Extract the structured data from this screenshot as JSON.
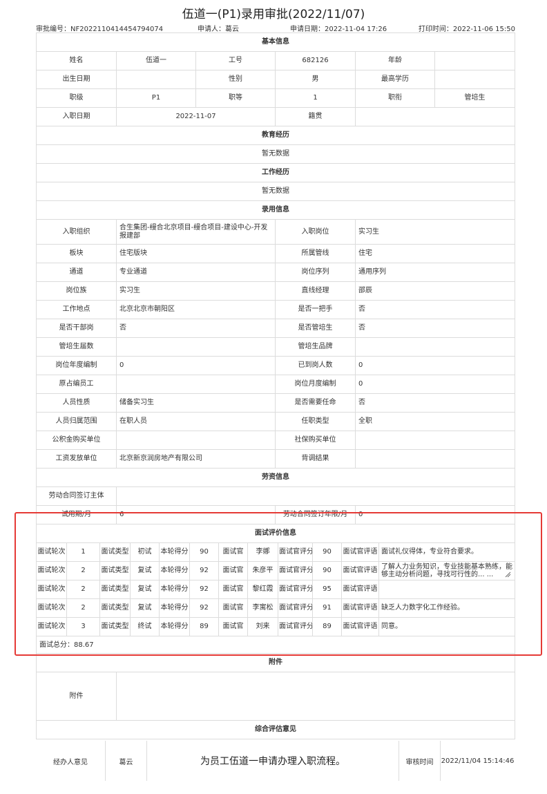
{
  "title": "伍道一(P1)录用审批(2022/11/07)",
  "meta": {
    "approval_no": "审批编号：NF20221104144547940​74",
    "applicant": "申请人：葛云",
    "apply_date": "申请日期：2022-11-04 17:26",
    "print_time": "打印时间：2022-11-06 15:50"
  },
  "sections": {
    "basic": "基本信息",
    "education": "教育经历",
    "work": "工作经历",
    "hire": "录用信息",
    "labor": "劳资信息",
    "interview": "面试评价信息",
    "attachment": "附件",
    "overall": "综合评估意见"
  },
  "basic": {
    "name_label": "姓名",
    "name": "伍道一",
    "empno_label": "工号",
    "empno": "682126",
    "age_label": "年龄",
    "age": "",
    "birth_label": "出生日期",
    "birth": "",
    "gender_label": "性别",
    "gender": "男",
    "degree_label": "最高学历",
    "degree": "",
    "level_label": "职级",
    "level": "P1",
    "grade_label": "职等",
    "grade": "1",
    "rank_label": "职衔",
    "rank": "管培生",
    "entry_label": "入职日期",
    "entry": "2022-11-07",
    "origin_label": "籍贯",
    "origin": ""
  },
  "education_empty": "暂无数据",
  "work_empty": "暂无数据",
  "hire_rows": [
    [
      "入职组织",
      "合生集团-缦合北京项目-缦合项目-建设中心-开发报建部",
      "入职岗位",
      "实习生"
    ],
    [
      "板块",
      "住宅版块",
      "所属管线",
      "住宅"
    ],
    [
      "通道",
      "专业通道",
      "岗位序列",
      "通用序列"
    ],
    [
      "岗位族",
      "实习生",
      "直线经理",
      "邵辰"
    ],
    [
      "工作地点",
      "北京北京市朝阳区",
      "是否一把手",
      "否"
    ],
    [
      "是否干部岗",
      "否",
      "是否管培生",
      "否"
    ],
    [
      "管培生届数",
      "",
      "管培生品牌",
      ""
    ],
    [
      "岗位年度编制",
      "0",
      "已到岗人数",
      "0"
    ],
    [
      "原占编员工",
      "",
      "岗位月度编制",
      "0"
    ],
    [
      "人员性质",
      "储备实习生",
      "是否需要任命",
      "否"
    ],
    [
      "人员归属范围",
      "在职人员",
      "任职类型",
      "全职"
    ],
    [
      "公积金购买单位",
      "",
      "社保购买单位",
      ""
    ],
    [
      "工资发放单位",
      "北京新京润房地产有限公司",
      "背调结果",
      ""
    ]
  ],
  "labor": {
    "contract_label": "劳动合同签订主体",
    "contract": "",
    "probation_label": "试用期/月",
    "probation": "6",
    "term_label": "劳动合同签订年限/月",
    "term": "0"
  },
  "interview": {
    "labels": {
      "round": "面试轮次",
      "type": "面试类型",
      "score": "本轮得分",
      "interviewer": "面试官",
      "iscore": "面试官评分",
      "comment": "面试官评语"
    },
    "rows": [
      {
        "round": "1",
        "type": "初试",
        "score": "90",
        "interviewer": "李娜",
        "iscore": "90",
        "comment": "面试礼仪得体，专业符合要求。"
      },
      {
        "round": "2",
        "type": "复试",
        "score": "92",
        "interviewer": "朱彦平",
        "iscore": "90",
        "comment": "了解人力业务知识，专业技能基本熟练，能够主动分析问题，寻找可行性的... ..."
      },
      {
        "round": "2",
        "type": "复试",
        "score": "92",
        "interviewer": "黎红霞",
        "iscore": "95",
        "comment": ""
      },
      {
        "round": "2",
        "type": "复试",
        "score": "92",
        "interviewer": "李寓松",
        "iscore": "91",
        "comment": "缺乏人力数字化工作经验。"
      },
      {
        "round": "3",
        "type": "终试",
        "score": "89",
        "interviewer": "刘来",
        "iscore": "89",
        "comment": "同意。"
      }
    ],
    "total": "面试总分：88.67"
  },
  "attachment_label": "附件",
  "overall": {
    "handler_label": "经办人意见",
    "handler": "葛云",
    "opinion": "为员工伍道一申请办理入职流程。",
    "time_label": "审核时间",
    "time": "2022/11/04 15:14:46"
  },
  "colors": {
    "highlight": "#e53935",
    "border": "#dcdcdc"
  }
}
